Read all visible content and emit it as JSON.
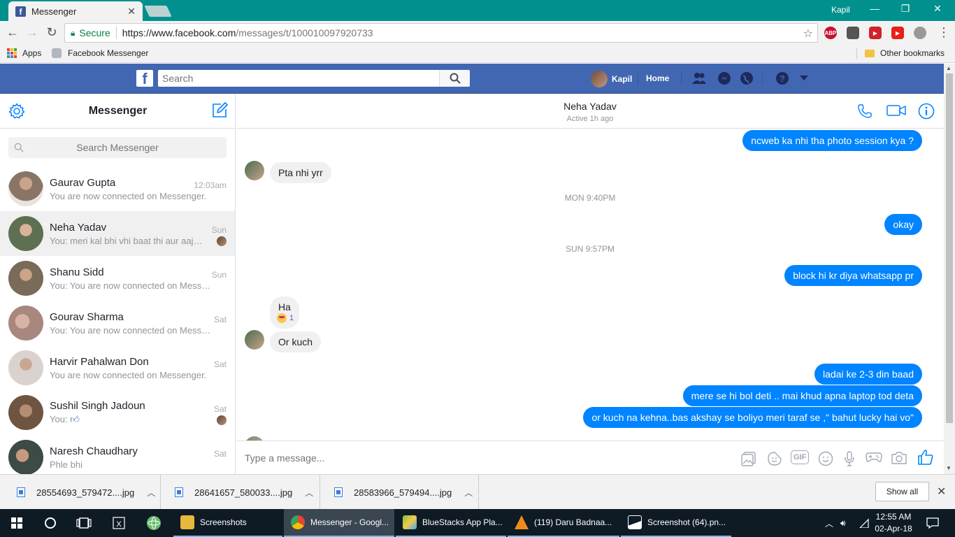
{
  "browser": {
    "tab_title": "Messenger",
    "user": "Kapil",
    "secure_label": "Secure",
    "url_host": "https://www.facebook.com",
    "url_path": "/messages/t/100010097920733",
    "bookmarks": {
      "apps": "Apps",
      "fb_messenger": "Facebook Messenger",
      "other": "Other bookmarks"
    },
    "extensions": [
      "ABP"
    ]
  },
  "fb": {
    "logo": "f",
    "search_placeholder": "Search",
    "user_name": "Kapil",
    "home": "Home"
  },
  "sidebar": {
    "title": "Messenger",
    "search_placeholder": "Search Messenger",
    "conversations": [
      {
        "name": "Gaurav Gupta",
        "snippet": "You are now connected on Messenger.",
        "time": "12:03am",
        "avatar_color": "#8a7466"
      },
      {
        "name": "Neha Yadav",
        "snippet": "You: meri kal bhi vhi baat thi aur aaj bhi ...",
        "time": "Sun",
        "avatar_color": "#5f6f51"
      },
      {
        "name": "Shanu Sidd",
        "snippet": "You: You are now connected on Messe...",
        "time": "Sun",
        "avatar_color": "#7a6b58"
      },
      {
        "name": "Gourav Sharma",
        "snippet": "You: You are now connected on Messe...",
        "time": "Sat",
        "avatar_color": "#a7877e"
      },
      {
        "name": "Harvir Pahalwan Don",
        "snippet": "You are now connected on Messenger.",
        "time": "Sat",
        "avatar_color": "#d9d2cf"
      },
      {
        "name": "Sushil Singh Jadoun",
        "snippet": "You:",
        "time": "Sat",
        "avatar_color": "#6f5442"
      },
      {
        "name": "Naresh Chaudhary",
        "snippet": "Phle bhi",
        "time": "Sat",
        "avatar_color": "#3e4a44"
      }
    ]
  },
  "chat": {
    "name": "Neha Yadav",
    "status": "Active 1h ago",
    "messages": {
      "m1": "ncweb ka nhi tha photo session kya ?",
      "m2": "Pta nhi yrr",
      "stamp1": "MON 9:40PM",
      "m3": "okay",
      "stamp2": "SUN 9:57PM",
      "m4": "block hi kr diya whatsapp pr",
      "m5": "Ha",
      "reaction_count": "1",
      "m6": "Or kuch",
      "m7": "ladai ke 2-3 din baad",
      "m8": "mere se hi bol deti .. mai khud apna laptop tod deta",
      "m9": "or kuch na kehna..bas akshay se boliyo meri taraf se ,\" bahut lucky hai vo\""
    },
    "composer_placeholder": "Type a message...",
    "gif_label": "GIF"
  },
  "downloads": {
    "items": [
      "28554693_579472....jpg",
      "28641657_580033....jpg",
      "28583966_579494....jpg"
    ],
    "show_all": "Show all"
  },
  "taskbar": {
    "items": [
      {
        "label": "Screenshots",
        "color": "#e8b83a"
      },
      {
        "label": "Messenger - Googl...",
        "color": "#4285f4"
      },
      {
        "label": "BlueStacks App Pla...",
        "color": "#7ac143"
      },
      {
        "label": "(119) Daru Badnaa...",
        "color": "#f08a1c"
      },
      {
        "label": "Screenshot (64).pn...",
        "color": "#ffffff"
      }
    ],
    "time": "12:55 AM",
    "date": "02-Apr-18"
  }
}
